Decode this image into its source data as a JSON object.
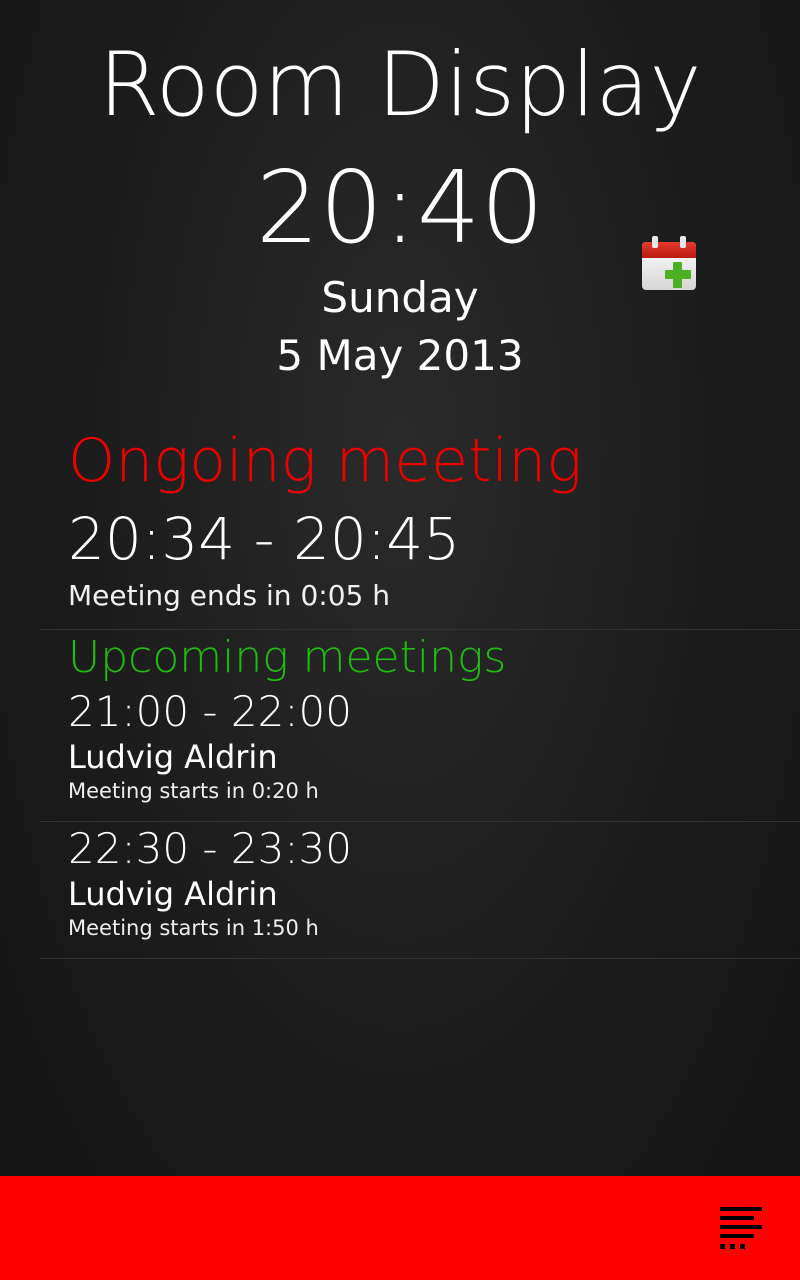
{
  "header": {
    "title": "Room Display",
    "time": "20:40",
    "weekday": "Sunday",
    "date": "5 May 2013",
    "add_event_icon": "calendar-add-icon"
  },
  "ongoing": {
    "heading": "Ongoing meeting",
    "heading_color": "#ee0000",
    "time_range": "20:34 - 20:45",
    "status": "Meeting ends in 0:05 h"
  },
  "upcoming": {
    "heading": "Upcoming meetings",
    "heading_color": "#22bb11",
    "meetings": [
      {
        "time_range": "21:00 - 22:00",
        "organizer": "Ludvig Aldrin",
        "status": "Meeting starts in 0:20 h"
      },
      {
        "time_range": "22:30 - 23:30",
        "organizer": "Ludvig Aldrin",
        "status": "Meeting starts in 1:50 h"
      }
    ]
  },
  "bottom_bar": {
    "color": "#ff0000",
    "menu_icon": "overflow-menu-icon"
  }
}
